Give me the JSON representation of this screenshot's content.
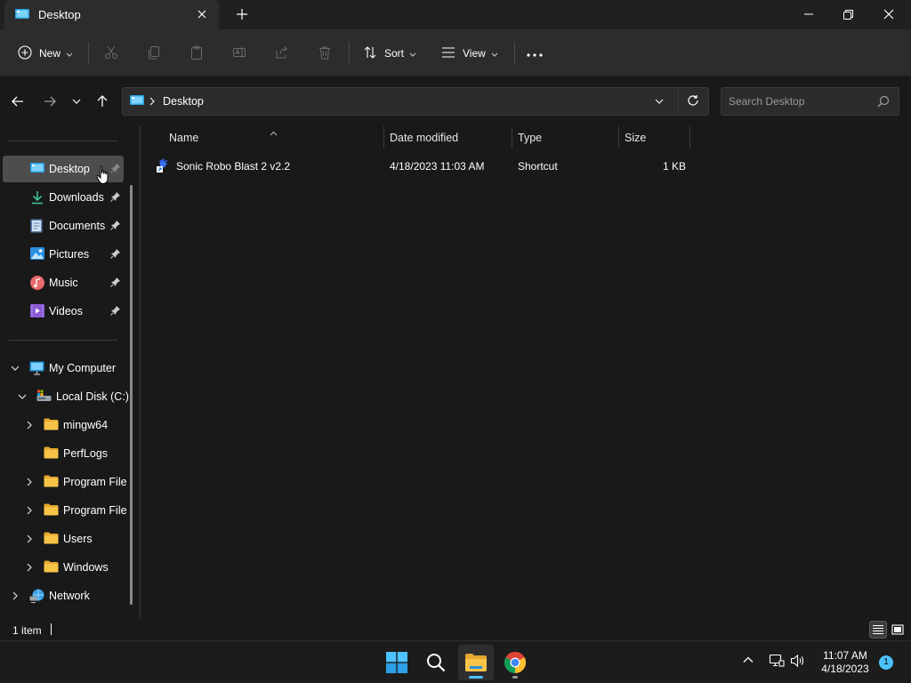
{
  "window": {
    "tab_title": "Desktop"
  },
  "toolbar": {
    "new_label": "New",
    "sort_label": "Sort",
    "view_label": "View"
  },
  "address": {
    "crumb": "Desktop",
    "search_placeholder": "Search Desktop"
  },
  "sidebar": {
    "quick_access": [
      {
        "label": "Desktop",
        "icon": "desktop-icon",
        "selected": true
      },
      {
        "label": "Downloads",
        "icon": "download-icon"
      },
      {
        "label": "Documents",
        "icon": "document-icon"
      },
      {
        "label": "Pictures",
        "icon": "pictures-icon"
      },
      {
        "label": "Music",
        "icon": "music-icon"
      },
      {
        "label": "Videos",
        "icon": "videos-icon"
      }
    ],
    "tree": [
      {
        "label": "My Computer",
        "icon": "computer-icon",
        "expanded": true
      },
      {
        "label": "Local Disk (C:)",
        "icon": "drive-icon",
        "expanded": true
      },
      {
        "label": "mingw64",
        "icon": "folder-icon"
      },
      {
        "label": "PerfLogs",
        "icon": "folder-icon"
      },
      {
        "label": "Program File",
        "icon": "folder-icon"
      },
      {
        "label": "Program File",
        "icon": "folder-icon"
      },
      {
        "label": "Users",
        "icon": "folder-icon"
      },
      {
        "label": "Windows",
        "icon": "folder-icon"
      },
      {
        "label": "Network",
        "icon": "network-icon"
      }
    ]
  },
  "columns": {
    "name": "Name",
    "date_modified": "Date modified",
    "type": "Type",
    "size": "Size"
  },
  "files": [
    {
      "name": "Sonic Robo Blast 2 v2.2",
      "date_modified": "4/18/2023 11:03 AM",
      "type": "Shortcut",
      "size": "1 KB"
    }
  ],
  "status": {
    "item_count": "1 item"
  },
  "taskbar": {
    "time": "11:07 AM",
    "date": "4/18/2023",
    "notification_count": "1"
  },
  "colors": {
    "accent": "#4cc2ff",
    "folder": "#f8c448",
    "background": "#191919"
  }
}
